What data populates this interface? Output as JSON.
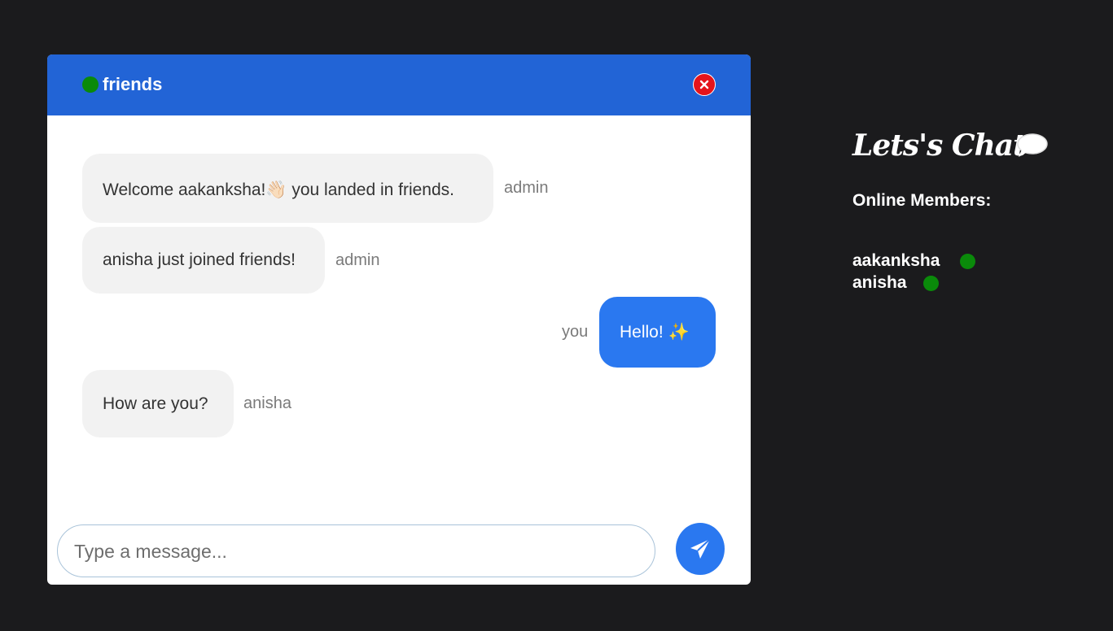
{
  "header": {
    "room_name": "friends",
    "status_color": "#0a8a0a",
    "close_icon": "close-icon"
  },
  "messages": [
    {
      "text": "Welcome aakanksha!👋🏻 you landed in friends.",
      "sender": "admin",
      "own": false
    },
    {
      "text": "anisha just joined friends!",
      "sender": "admin",
      "own": false
    },
    {
      "text": "Hello! ✨",
      "sender": "you",
      "own": true
    },
    {
      "text": "How are you?",
      "sender": "anisha",
      "own": false
    }
  ],
  "composer": {
    "placeholder": "Type a message...",
    "send_icon": "send-icon"
  },
  "sidebar": {
    "title": "Lets's Chat",
    "title_icon": "speech-bubble-icon",
    "members_heading": "Online Members:",
    "members": [
      {
        "name": "aakanksha",
        "online": true
      },
      {
        "name": "anisha",
        "online": true
      }
    ]
  },
  "colors": {
    "header_bg": "#2264d6",
    "own_bubble": "#2a78f0",
    "other_bubble": "#f2f2f2",
    "page_bg": "#1b1b1d",
    "close_red": "#e5141b"
  }
}
